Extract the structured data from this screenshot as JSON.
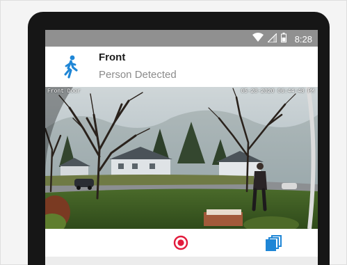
{
  "status_bar": {
    "time": "8:28",
    "icons": [
      "wifi-icon",
      "signal-icon",
      "battery-icon"
    ]
  },
  "notification": {
    "icon": "person-walking-icon",
    "title": "Front",
    "subtitle": "Person Detected",
    "accent_color": "#1f86d6"
  },
  "camera": {
    "label": "Front Door",
    "timestamp": "05-28-2020  06:44:48 PM"
  },
  "actions": {
    "record_icon": "record-icon",
    "record_color": "#e21b3c",
    "clips_icon": "clips-stack-icon",
    "clips_color": "#1f86d6"
  }
}
